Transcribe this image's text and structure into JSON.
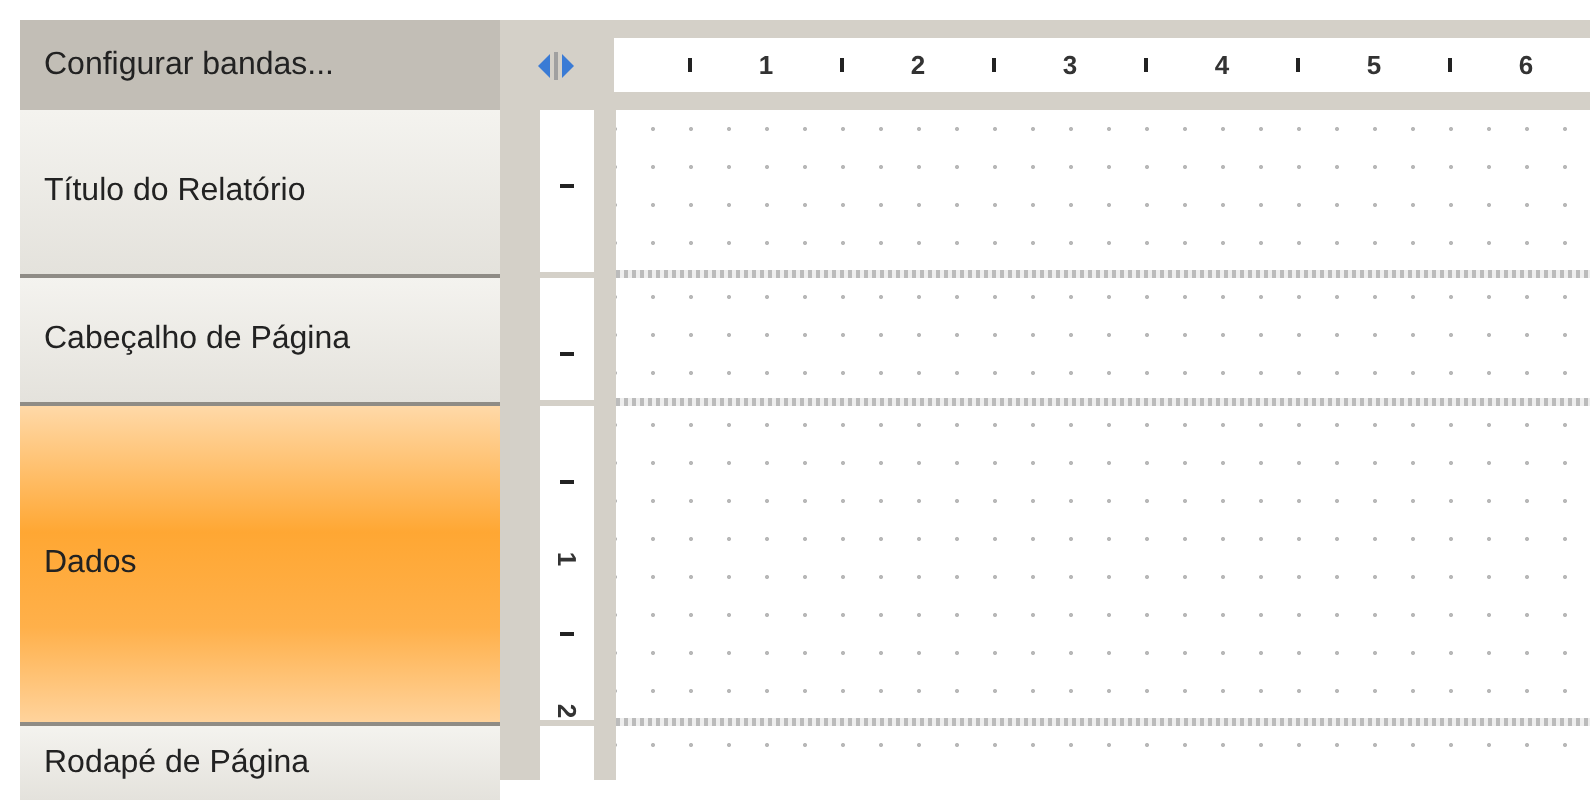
{
  "header": {
    "label": "Configurar bandas..."
  },
  "horizontal_ruler": [
    {
      "kind": "tick"
    },
    {
      "kind": "label",
      "text": "1"
    },
    {
      "kind": "tick"
    },
    {
      "kind": "label",
      "text": "2"
    },
    {
      "kind": "tick"
    },
    {
      "kind": "label",
      "text": "3"
    },
    {
      "kind": "tick"
    },
    {
      "kind": "label",
      "text": "4"
    },
    {
      "kind": "tick"
    },
    {
      "kind": "label",
      "text": "5"
    },
    {
      "kind": "tick"
    },
    {
      "kind": "label",
      "text": "6"
    }
  ],
  "bands": [
    {
      "name": "Título do Relatório",
      "selected": false,
      "ruler": [
        {
          "kind": "tick"
        }
      ]
    },
    {
      "name": "Cabeçalho de Página",
      "selected": false,
      "ruler": [
        {
          "kind": "tick"
        }
      ]
    },
    {
      "name": "Dados",
      "selected": true,
      "ruler": [
        {
          "kind": "tick"
        },
        {
          "kind": "label",
          "text": "1"
        },
        {
          "kind": "tick"
        },
        {
          "kind": "label",
          "text": "2"
        }
      ]
    },
    {
      "name": "Rodapé de Página",
      "selected": false
    }
  ]
}
